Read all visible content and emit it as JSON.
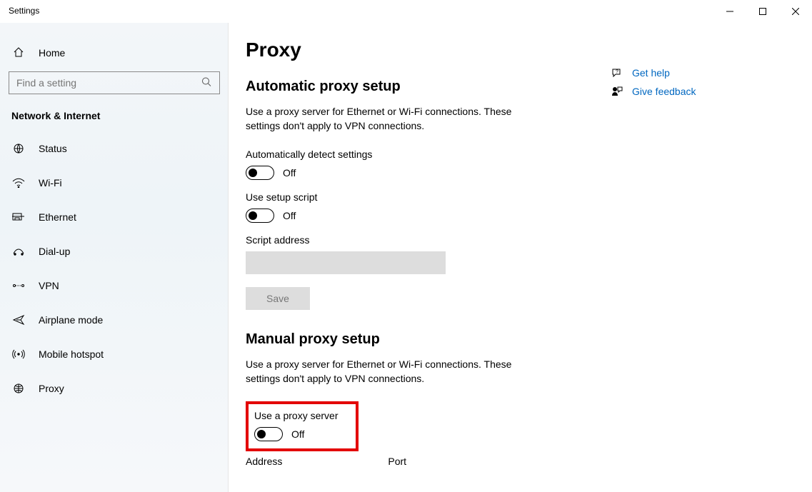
{
  "window": {
    "title": "Settings"
  },
  "sidebar": {
    "home": "Home",
    "search_placeholder": "Find a setting",
    "category": "Network & Internet",
    "items": [
      {
        "label": "Status"
      },
      {
        "label": "Wi-Fi"
      },
      {
        "label": "Ethernet"
      },
      {
        "label": "Dial-up"
      },
      {
        "label": "VPN"
      },
      {
        "label": "Airplane mode"
      },
      {
        "label": "Mobile hotspot"
      },
      {
        "label": "Proxy"
      }
    ]
  },
  "page": {
    "title": "Proxy",
    "auto": {
      "heading": "Automatic proxy setup",
      "desc": "Use a proxy server for Ethernet or Wi-Fi connections. These settings don't apply to VPN connections.",
      "detect_label": "Automatically detect settings",
      "detect_state": "Off",
      "script_label": "Use setup script",
      "script_state": "Off",
      "script_addr_label": "Script address",
      "save": "Save"
    },
    "manual": {
      "heading": "Manual proxy setup",
      "desc": "Use a proxy server for Ethernet or Wi-Fi connections. These settings don't apply to VPN connections.",
      "use_label": "Use a proxy server",
      "use_state": "Off",
      "address_label": "Address",
      "port_label": "Port"
    }
  },
  "help": {
    "get_help": "Get help",
    "feedback": "Give feedback"
  }
}
